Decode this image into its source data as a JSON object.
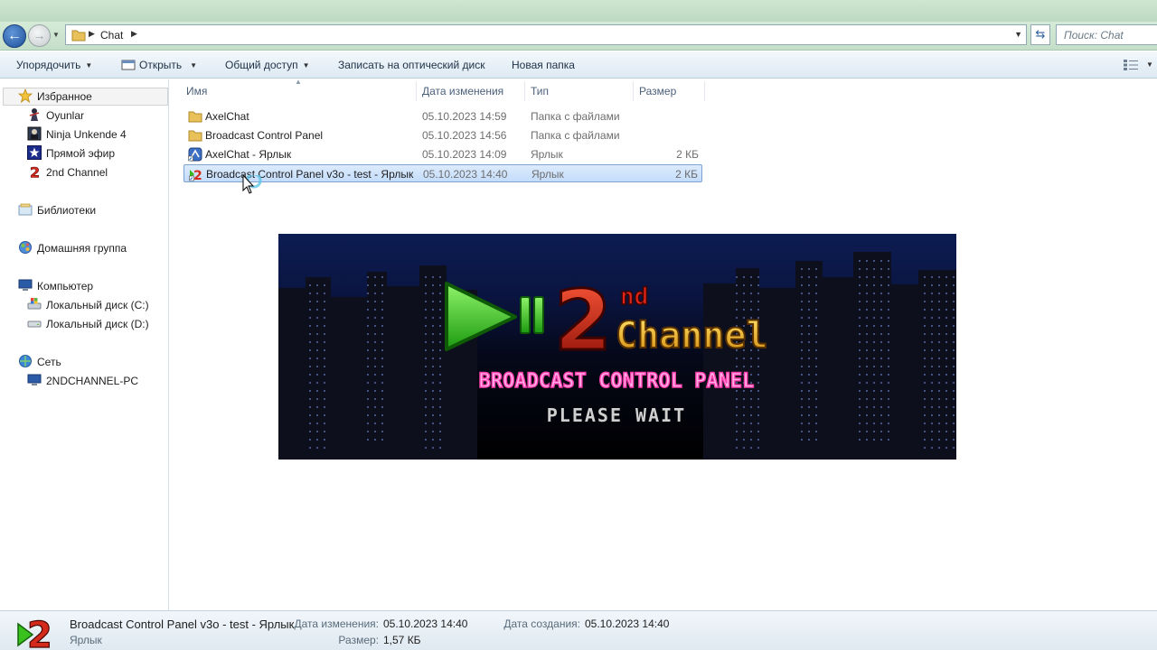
{
  "address": {
    "crumbs": [
      "Chat"
    ],
    "search_placeholder": "Поиск: Chat"
  },
  "toolbar": {
    "organize": "Упорядочить",
    "open": "Открыть",
    "share": "Общий доступ",
    "burn": "Записать на оптический диск",
    "new_folder": "Новая папка"
  },
  "nav": {
    "favorites": "Избранное",
    "favorites_items": [
      "Oyunlar",
      "Ninja Unkende 4",
      "Прямой эфир",
      "2nd Channel"
    ],
    "libraries": "Библиотеки",
    "homegroup": "Домашняя группа",
    "computer": "Компьютер",
    "drives": [
      "Локальный диск (C:)",
      "Локальный диск (D:)"
    ],
    "network": "Сеть",
    "network_items": [
      "2NDCHANNEL-PC"
    ]
  },
  "columns": {
    "name": "Имя",
    "date": "Дата изменения",
    "type": "Тип",
    "size": "Размер"
  },
  "files": [
    {
      "name": "AxelChat",
      "date": "05.10.2023 14:59",
      "type": "Папка с файлами",
      "size": "",
      "icon": "folder-icon"
    },
    {
      "name": "Broadcast Control Panel",
      "date": "05.10.2023 14:56",
      "type": "Папка с файлами",
      "size": "",
      "icon": "folder-icon"
    },
    {
      "name": "AxelChat - Ярлык",
      "date": "05.10.2023 14:09",
      "type": "Ярлык",
      "size": "2 КБ",
      "icon": "axelchat-shortcut-icon"
    },
    {
      "name": "Broadcast Control Panel v3o - test - Ярлык",
      "date": "05.10.2023 14:40",
      "type": "Ярлык",
      "size": "2 КБ",
      "icon": "2nd-channel-shortcut-icon",
      "selected": true
    }
  ],
  "splash": {
    "logo_number": "2",
    "logo_superscript": "nd",
    "logo_word": "Channel",
    "subtitle": "BROADCAST CONTROL PANEL",
    "status": "PLEASE WAIT"
  },
  "details": {
    "name": "Broadcast Control Panel v3o - test - Ярлык",
    "kind": "Ярлык",
    "modified_label": "Дата изменения:",
    "modified_value": "05.10.2023 14:40",
    "size_label": "Размер:",
    "size_value": "1,57 КБ",
    "created_label": "Дата создания:",
    "created_value": "05.10.2023 14:40"
  },
  "colors": {
    "selection": "#cce3fb",
    "chrome_green": "#c9e3cd",
    "splash_pink": "#ff6ec8",
    "logo_green": "#39d21e",
    "logo_red": "#e0241a",
    "logo_yellow": "#f2c21b"
  }
}
